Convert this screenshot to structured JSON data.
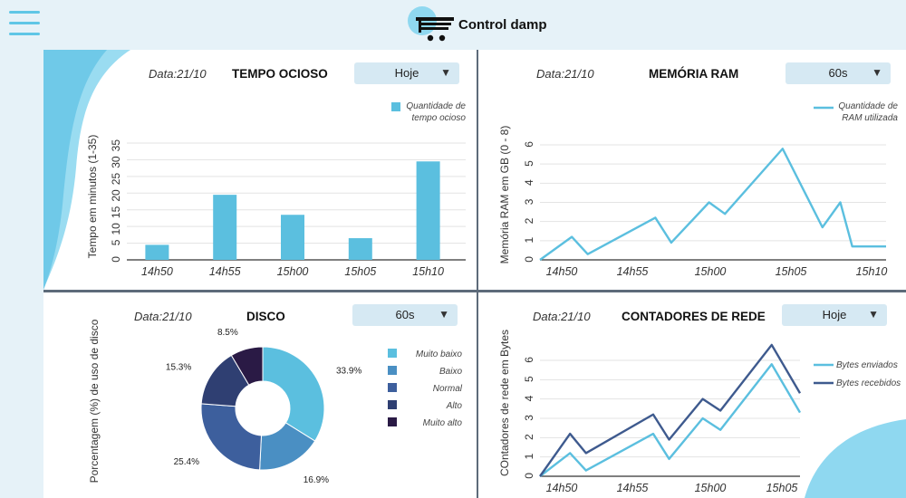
{
  "header": {
    "app_title": "Control damp",
    "menu_icon": "hamburger-menu-icon",
    "logo_icon": "cart-logo-icon"
  },
  "colors": {
    "accent": "#5bbfdf",
    "panel_select": "#d6e9f3",
    "background": "#e6f2f8",
    "network_received": "#3e5a8e"
  },
  "panels": {
    "idle": {
      "date": "Data:21/10",
      "title": "TEMPO OCIOSO",
      "select": "Hoje"
    },
    "ram": {
      "date": "Data:21/10",
      "title": "MEMÓRIA RAM",
      "select": "60s"
    },
    "disk": {
      "date": "Data:21/10",
      "title": "DISCO",
      "select": "60s"
    },
    "network": {
      "date": "Data:21/10",
      "title": "CONTADORES DE REDE",
      "select": "Hoje"
    }
  },
  "chart_data": [
    {
      "type": "bar",
      "title": "TEMPO OCIOSO",
      "categories": [
        "14h50",
        "14h55",
        "15h00",
        "15h05",
        "15h10"
      ],
      "series": [
        {
          "name": "Quantidade de tempo ocioso",
          "values": [
            4.5,
            19.5,
            13.5,
            6.5,
            29.5
          ]
        }
      ],
      "ylabel": "Tempo em minutos (1-35)",
      "ylim": [
        0,
        35
      ],
      "yticks": [
        0,
        5,
        10,
        15,
        20,
        25,
        30,
        35
      ],
      "legend_lines": [
        "Quantidade de",
        "tempo ocioso"
      ],
      "legend": "top-right",
      "grid": true
    },
    {
      "type": "line",
      "title": "MEMÓRIA RAM",
      "xticks": [
        "14h50",
        "14h55",
        "15h00",
        "15h05",
        "15h10"
      ],
      "x": [
        0,
        0.8,
        1.2,
        2.9,
        3.3,
        4.25,
        4.65,
        6.1,
        7.1,
        7.55,
        7.85,
        8.7
      ],
      "series": [
        {
          "name": "Quantidade de RAM utilizada",
          "values": [
            0,
            1.2,
            0.3,
            2.2,
            0.9,
            3,
            2.4,
            5.8,
            1.7,
            3,
            0.7,
            0.7
          ]
        }
      ],
      "ylabel": "Memória RAM em GB (0 - 8)",
      "ylim": [
        0,
        6
      ],
      "yticks": [
        0,
        1,
        2,
        3,
        4,
        5,
        6
      ],
      "legend_lines": [
        "Quantidade de",
        "RAM utilizada"
      ],
      "legend": "top-right",
      "grid": true
    },
    {
      "type": "pie",
      "title": "DISCO",
      "ylabel": "Porcentagem (%) de uso de disco",
      "labels": [
        "Muito baixo",
        "Baixo",
        "Normal",
        "Alto",
        "Muito alto"
      ],
      "values": [
        33.9,
        16.9,
        25.4,
        15.3,
        8.5
      ],
      "value_labels": [
        "33.9%",
        "16.9%",
        "25.4%",
        "15.3%",
        "8.5%"
      ],
      "colors": [
        "#5bbfdf",
        "#4a8fc3",
        "#3d5f9d",
        "#2f3f72",
        "#2a1a45"
      ],
      "legend": "right"
    },
    {
      "type": "line",
      "title": "CONTADORES DE REDE",
      "xticks": [
        "14h50",
        "14h55",
        "15h00",
        "15h05"
      ],
      "x": [
        0,
        0.85,
        1.3,
        3.2,
        3.65,
        4.6,
        5.1,
        6.55,
        7.35
      ],
      "series": [
        {
          "name": "Bytes enviados",
          "values": [
            0,
            1.2,
            0.3,
            2.2,
            0.9,
            3,
            2.4,
            5.8,
            3.3
          ]
        },
        {
          "name": "Bytes recebidos",
          "values": [
            0,
            2.2,
            1.2,
            3.2,
            1.9,
            4,
            3.4,
            6.8,
            4.3
          ]
        }
      ],
      "series_colors": [
        "#5bbfdf",
        "#3e5a8e"
      ],
      "ylabel": "COntadores de rede em Bytes",
      "ylim": [
        0,
        6
      ],
      "yticks": [
        0,
        1,
        2,
        3,
        4,
        5,
        6
      ],
      "legend": "right",
      "grid": true
    }
  ]
}
